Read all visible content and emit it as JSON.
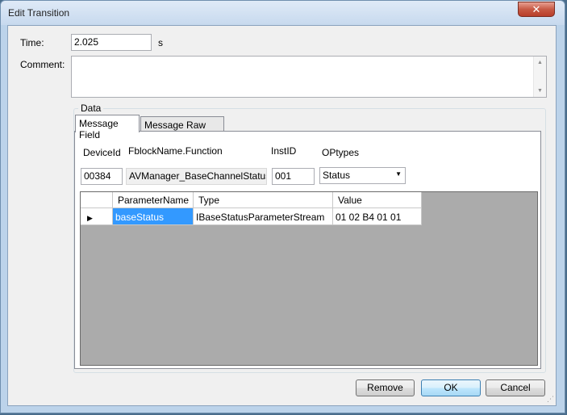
{
  "window": {
    "title": "Edit Transition",
    "close_glyph": "✕"
  },
  "form": {
    "time_label": "Time:",
    "time_value": "2.025",
    "time_unit": "s",
    "comment_label": "Comment:",
    "comment_value": ""
  },
  "data_group": {
    "title": "Data",
    "tabs": [
      {
        "label": "Message Field",
        "active": true
      },
      {
        "label": "Message Raw Data",
        "active": false
      }
    ],
    "fields": {
      "device_id_label": "DeviceId",
      "device_id_value": "00384",
      "fblock_label": "FblockName.Function",
      "fblock_value": "AVManager_BaseChannelStatus",
      "inst_id_label": "InstID",
      "inst_id_value": "001",
      "optypes_label": "OPtypes",
      "optypes_value": "Status"
    },
    "grid": {
      "columns": [
        "ParameterName",
        "Type",
        "Value"
      ],
      "rows": [
        {
          "indicator": "▶",
          "parameter": "baseStatus",
          "type": "IBaseStatusParameterStream",
          "value": "01 02 B4 01 01"
        }
      ]
    }
  },
  "buttons": {
    "remove": "Remove",
    "ok": "OK",
    "cancel": "Cancel"
  },
  "icons": {
    "close": "close-icon",
    "dropdown": "chevron-down-icon",
    "row_indicator": "current-row-icon",
    "resize_grip": "resize-grip-icon"
  },
  "colors": {
    "selection": "#3399ff",
    "grid_background": "#ababab",
    "close_button": "#c75a45"
  }
}
